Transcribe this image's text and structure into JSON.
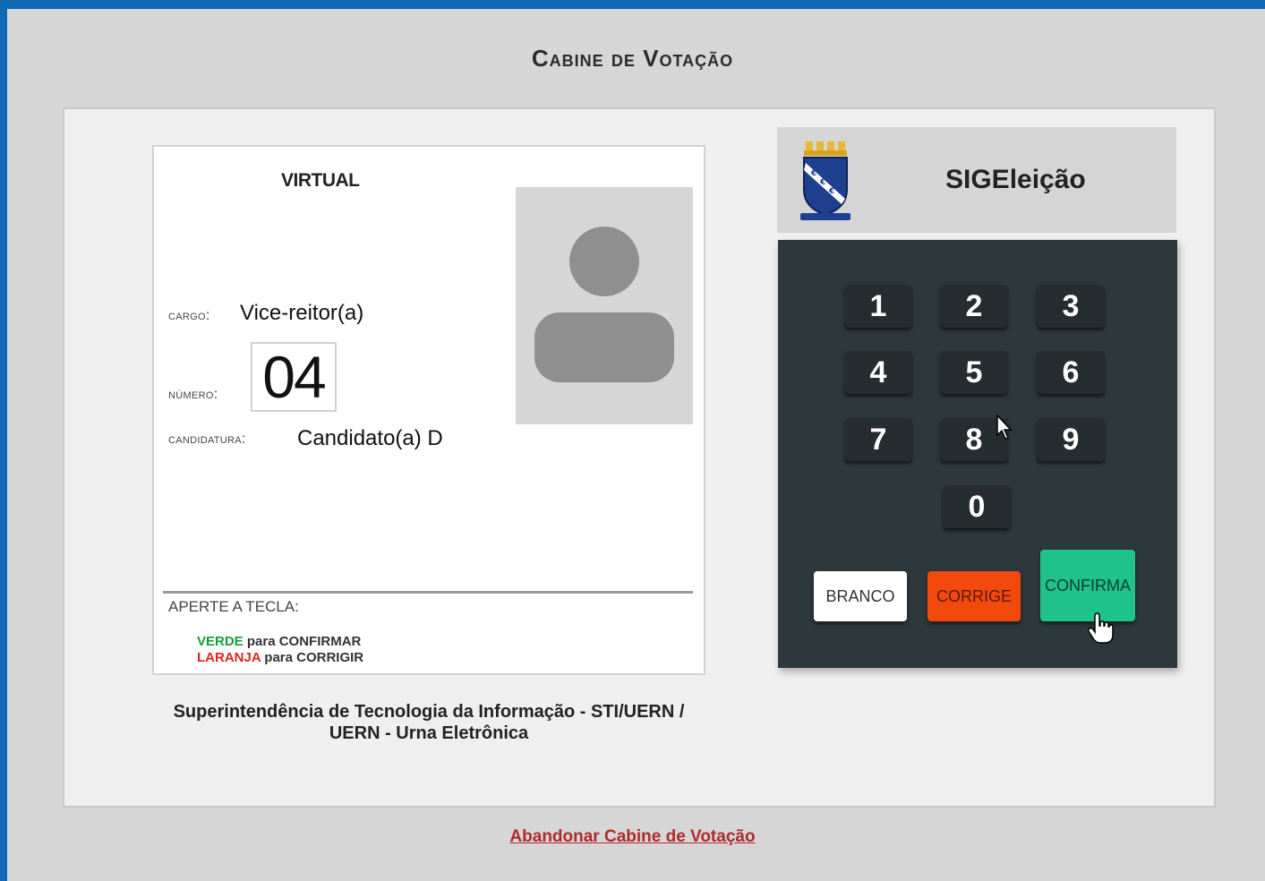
{
  "page": {
    "title": "Cabine de Votação",
    "leave_link": "Abandonar Cabine de Votação"
  },
  "screen": {
    "title": "VIRTUAL",
    "cargo_label": "cargo:",
    "cargo_value": "Vice-reitor(a)",
    "numero_label": "número:",
    "numero_value": "04",
    "candidatura_label": "candidatura:",
    "candidatura_value": "Candidato(a) D",
    "instructions_title": "APERTE A TECLA:",
    "instr_green_word": "VERDE",
    "instr_green_rest": " para CONFIRMAR",
    "instr_orange_word": "LARANJA",
    "instr_orange_rest": " para CORRIGIR"
  },
  "footer": {
    "line1": "Superintendência de Tecnologia da Informação - STI/UERN /",
    "line2": "UERN - Urna Eletrônica"
  },
  "brand": {
    "name": "SIGEleição",
    "logo_icon": "uern-crest-icon"
  },
  "keypad": {
    "keys": [
      "1",
      "2",
      "3",
      "4",
      "5",
      "6",
      "7",
      "8",
      "9",
      "0"
    ],
    "branco": "BRANCO",
    "corrige": "CORRIGE",
    "confirma": "CONFIRMA"
  },
  "colors": {
    "accent_blue": "#0f6ab6",
    "keypad_bg": "#2d383c",
    "confirma": "#1fc28a",
    "corrige": "#f24a0c",
    "branco": "#ffffff",
    "link": "#b02a2a"
  }
}
